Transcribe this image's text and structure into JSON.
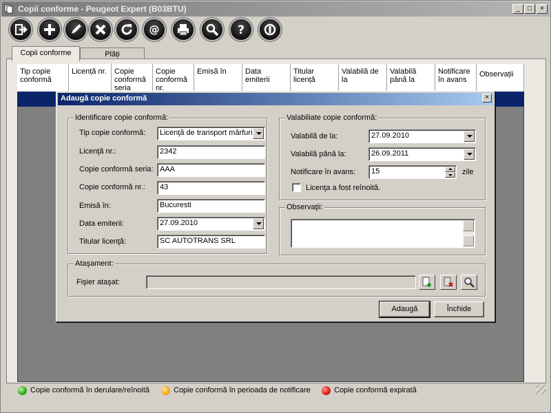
{
  "window": {
    "title": "Copii conforme - Peugeot Expert (B03BTU)",
    "controls": [
      "_",
      "□",
      "×"
    ]
  },
  "toolbar": {
    "buttons": [
      {
        "name": "exit-icon"
      },
      {
        "name": "add-icon"
      },
      {
        "name": "edit-icon"
      },
      {
        "name": "delete-icon"
      },
      {
        "name": "refresh-icon"
      },
      {
        "name": "email-icon"
      },
      {
        "name": "print-icon"
      },
      {
        "name": "search-icon"
      },
      {
        "name": "help-icon"
      },
      {
        "name": "power-icon"
      }
    ]
  },
  "tabs": [
    {
      "label": "Copii conforme",
      "active": true
    },
    {
      "label": "Plăți",
      "active": false
    }
  ],
  "grid": {
    "columns": [
      "Tip copie conformă",
      "Licență nr.",
      "Copie conformă seria",
      "Copie conformă nr.",
      "Emisă în",
      "Data emiterii",
      "Titular licență",
      "Valabilă de la",
      "Valabilă până la",
      "Notificare în avans",
      "Observații"
    ]
  },
  "dialog": {
    "title": "Adaugă copie conformă",
    "close": "×",
    "identification": {
      "title": "Identificare copie conformă:",
      "fields": {
        "tip_label": "Tip copie conformă:",
        "tip_value": "Licenţă de transport mărfuri",
        "licenta_label": "Licenţă nr.:",
        "licenta_value": "2342",
        "seria_label": "Copie conformă seria:",
        "seria_value": "AAA",
        "nr_label": "Copie conformă nr.:",
        "nr_value": "43",
        "emisa_label": "Emisă în:",
        "emisa_value": "Bucuresti",
        "data_label": "Data emiterii:",
        "data_value": "27.09.2010",
        "titular_label": "Titular licenţă:",
        "titular_value": "SC AUTOTRANS SRL"
      }
    },
    "validity": {
      "title": "Valabiliate copie conformă:",
      "de_la_label": "Valabilă de la:",
      "de_la_value": "27.09.2010",
      "pana_label": "Valabilă până la:",
      "pana_value": "26.09.2011",
      "notificare_label": "Notificare în avans:",
      "notificare_value": "15",
      "notificare_unit": "zile",
      "renewed_label": "Licenţa a fost reînoită.",
      "renewed_checked": false
    },
    "notes": {
      "title": "Observaţii:",
      "value": ""
    },
    "attachment": {
      "title": "Ataşament:",
      "file_label": "Fişier ataşat:",
      "file_value": ""
    },
    "buttons": {
      "add": "Adaugă",
      "close": "Închide"
    }
  },
  "legend": [
    {
      "color": "green",
      "label": "Copie conformă în derulare/reînoită"
    },
    {
      "color": "orange",
      "label": "Copie conformă în perioada de notificare"
    },
    {
      "color": "red",
      "label": "Copie conformă expirată"
    }
  ]
}
